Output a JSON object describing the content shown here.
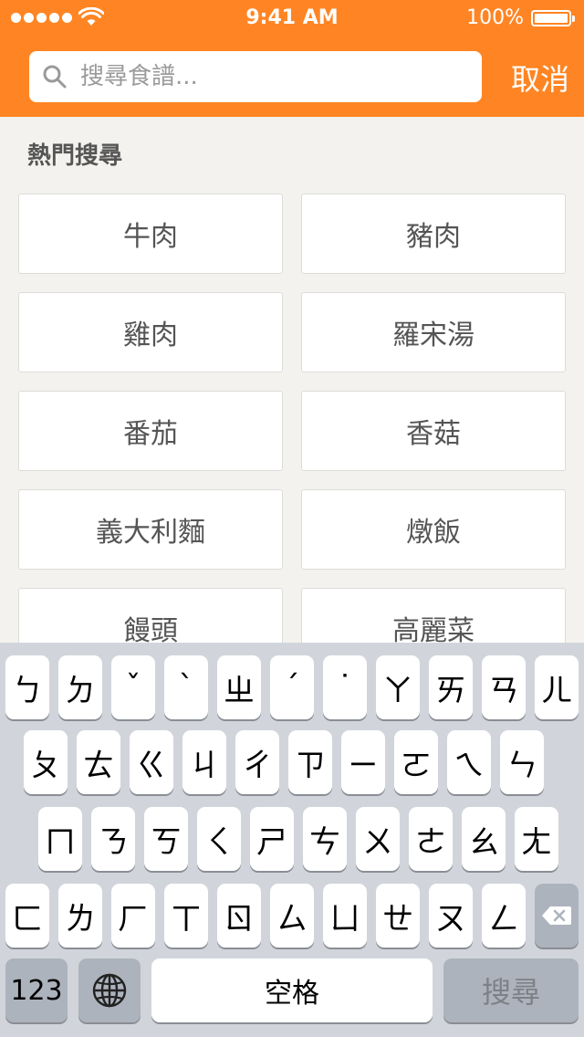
{
  "status_bar": {
    "time": "9:41 AM",
    "battery": "100%"
  },
  "search": {
    "placeholder": "搜尋食譜...",
    "value": "",
    "cancel_label": "取消"
  },
  "popular": {
    "title": "熱門搜尋",
    "items": [
      "牛肉",
      "豬肉",
      "雞肉",
      "羅宋湯",
      "番茄",
      "香菇",
      "義大利麵",
      "燉飯",
      "饅頭",
      "高麗菜"
    ]
  },
  "keyboard": {
    "rows": [
      [
        "ㄅ",
        "ㄉ",
        "ˇ",
        "ˋ",
        "ㄓ",
        "ˊ",
        "˙",
        "ㄚ",
        "ㄞ",
        "ㄢ",
        "ㄦ"
      ],
      [
        "ㄆ",
        "ㄊ",
        "ㄍ",
        "ㄐ",
        "ㄔ",
        "ㄗ",
        "ㄧ",
        "ㄛ",
        "ㄟ",
        "ㄣ"
      ],
      [
        "ㄇ",
        "ㄋ",
        "ㄎ",
        "ㄑ",
        "ㄕ",
        "ㄘ",
        "ㄨ",
        "ㄜ",
        "ㄠ",
        "ㄤ"
      ],
      [
        "ㄈ",
        "ㄌ",
        "ㄏ",
        "ㄒ",
        "ㄖ",
        "ㄙ",
        "ㄩ",
        "ㄝ",
        "ㄡ",
        "ㄥ"
      ]
    ],
    "numbers_label": "123",
    "space_label": "空格",
    "search_label": "搜尋",
    "globe_icon": "globe-icon",
    "delete_icon": "delete-icon"
  },
  "colors": {
    "accent": "#ff8524",
    "background": "#f4f2ee",
    "keyboard": "#d1d5db"
  }
}
